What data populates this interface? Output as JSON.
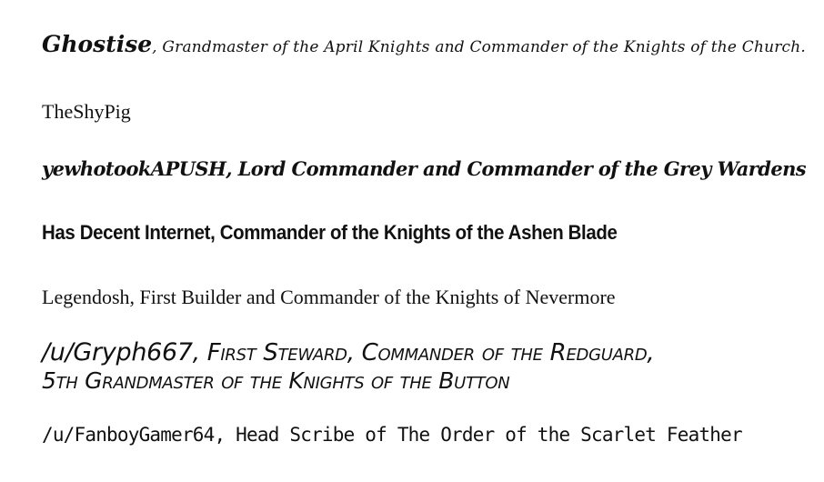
{
  "document": {
    "entries": [
      {
        "name": "Ghostise",
        "title": ", Grandmaster of the April Knights and Commander of the  Knights of the Church."
      },
      {
        "text": "TheShyPig"
      },
      {
        "text": "yewhotookAPUSH, Lord Commander and Commander of the Grey Wardens"
      },
      {
        "text": "Has Decent Internet, Commander of the Knights of the Ashen Blade"
      },
      {
        "text": "Legendosh, First Builder and Commander of the Knights of Nevermore"
      },
      {
        "name": "/u/Gryph667",
        "title_line1": ", First Steward, Commander of the Redguard,",
        "title_line2": "5th Grandmaster of the Knights of the Button"
      },
      {
        "text": "/u/FanboyGamer64, Head Scribe of The Order of the Scarlet Feather"
      }
    ]
  }
}
